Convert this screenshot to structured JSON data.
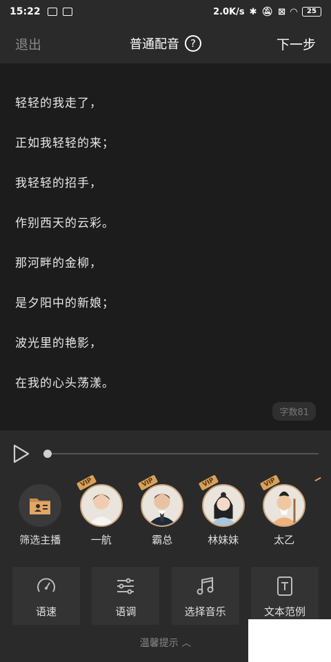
{
  "status_bar": {
    "time": "15:22",
    "net_speed": "2.0K/s",
    "battery": "25"
  },
  "header": {
    "exit_label": "退出",
    "title": "普通配音",
    "help_symbol": "?",
    "next_label": "下一步"
  },
  "editor": {
    "lines": [
      "轻轻的我走了，",
      "正如我轻轻的来；",
      "我轻轻的招手，",
      "作别西天的云彩。",
      "那河畔的金柳，",
      "是夕阳中的新娘；",
      "波光里的艳影，",
      "在我的心头荡漾。"
    ],
    "word_count": "字数81"
  },
  "player": {
    "progress": 0
  },
  "voices": {
    "filter_label": "筛选主播",
    "vip_badge": "VIP",
    "items": [
      {
        "name": "一航",
        "vip": true
      },
      {
        "name": "霸总",
        "vip": true
      },
      {
        "name": "林妹妹",
        "vip": true
      },
      {
        "name": "太乙",
        "vip": true
      }
    ]
  },
  "tools": [
    {
      "label": "语速",
      "icon": "speedometer-icon"
    },
    {
      "label": "语调",
      "icon": "sliders-icon"
    },
    {
      "label": "选择音乐",
      "icon": "music-note-icon"
    },
    {
      "label": "文本范例",
      "icon": "text-document-icon"
    }
  ],
  "tip": {
    "label": "温馨提示",
    "icon": "chevron-up-icon"
  },
  "colors": {
    "accent_gold": "#c9a37a",
    "editor_bg": "#1c1c1c",
    "panel_bg": "#2a2a2a"
  }
}
